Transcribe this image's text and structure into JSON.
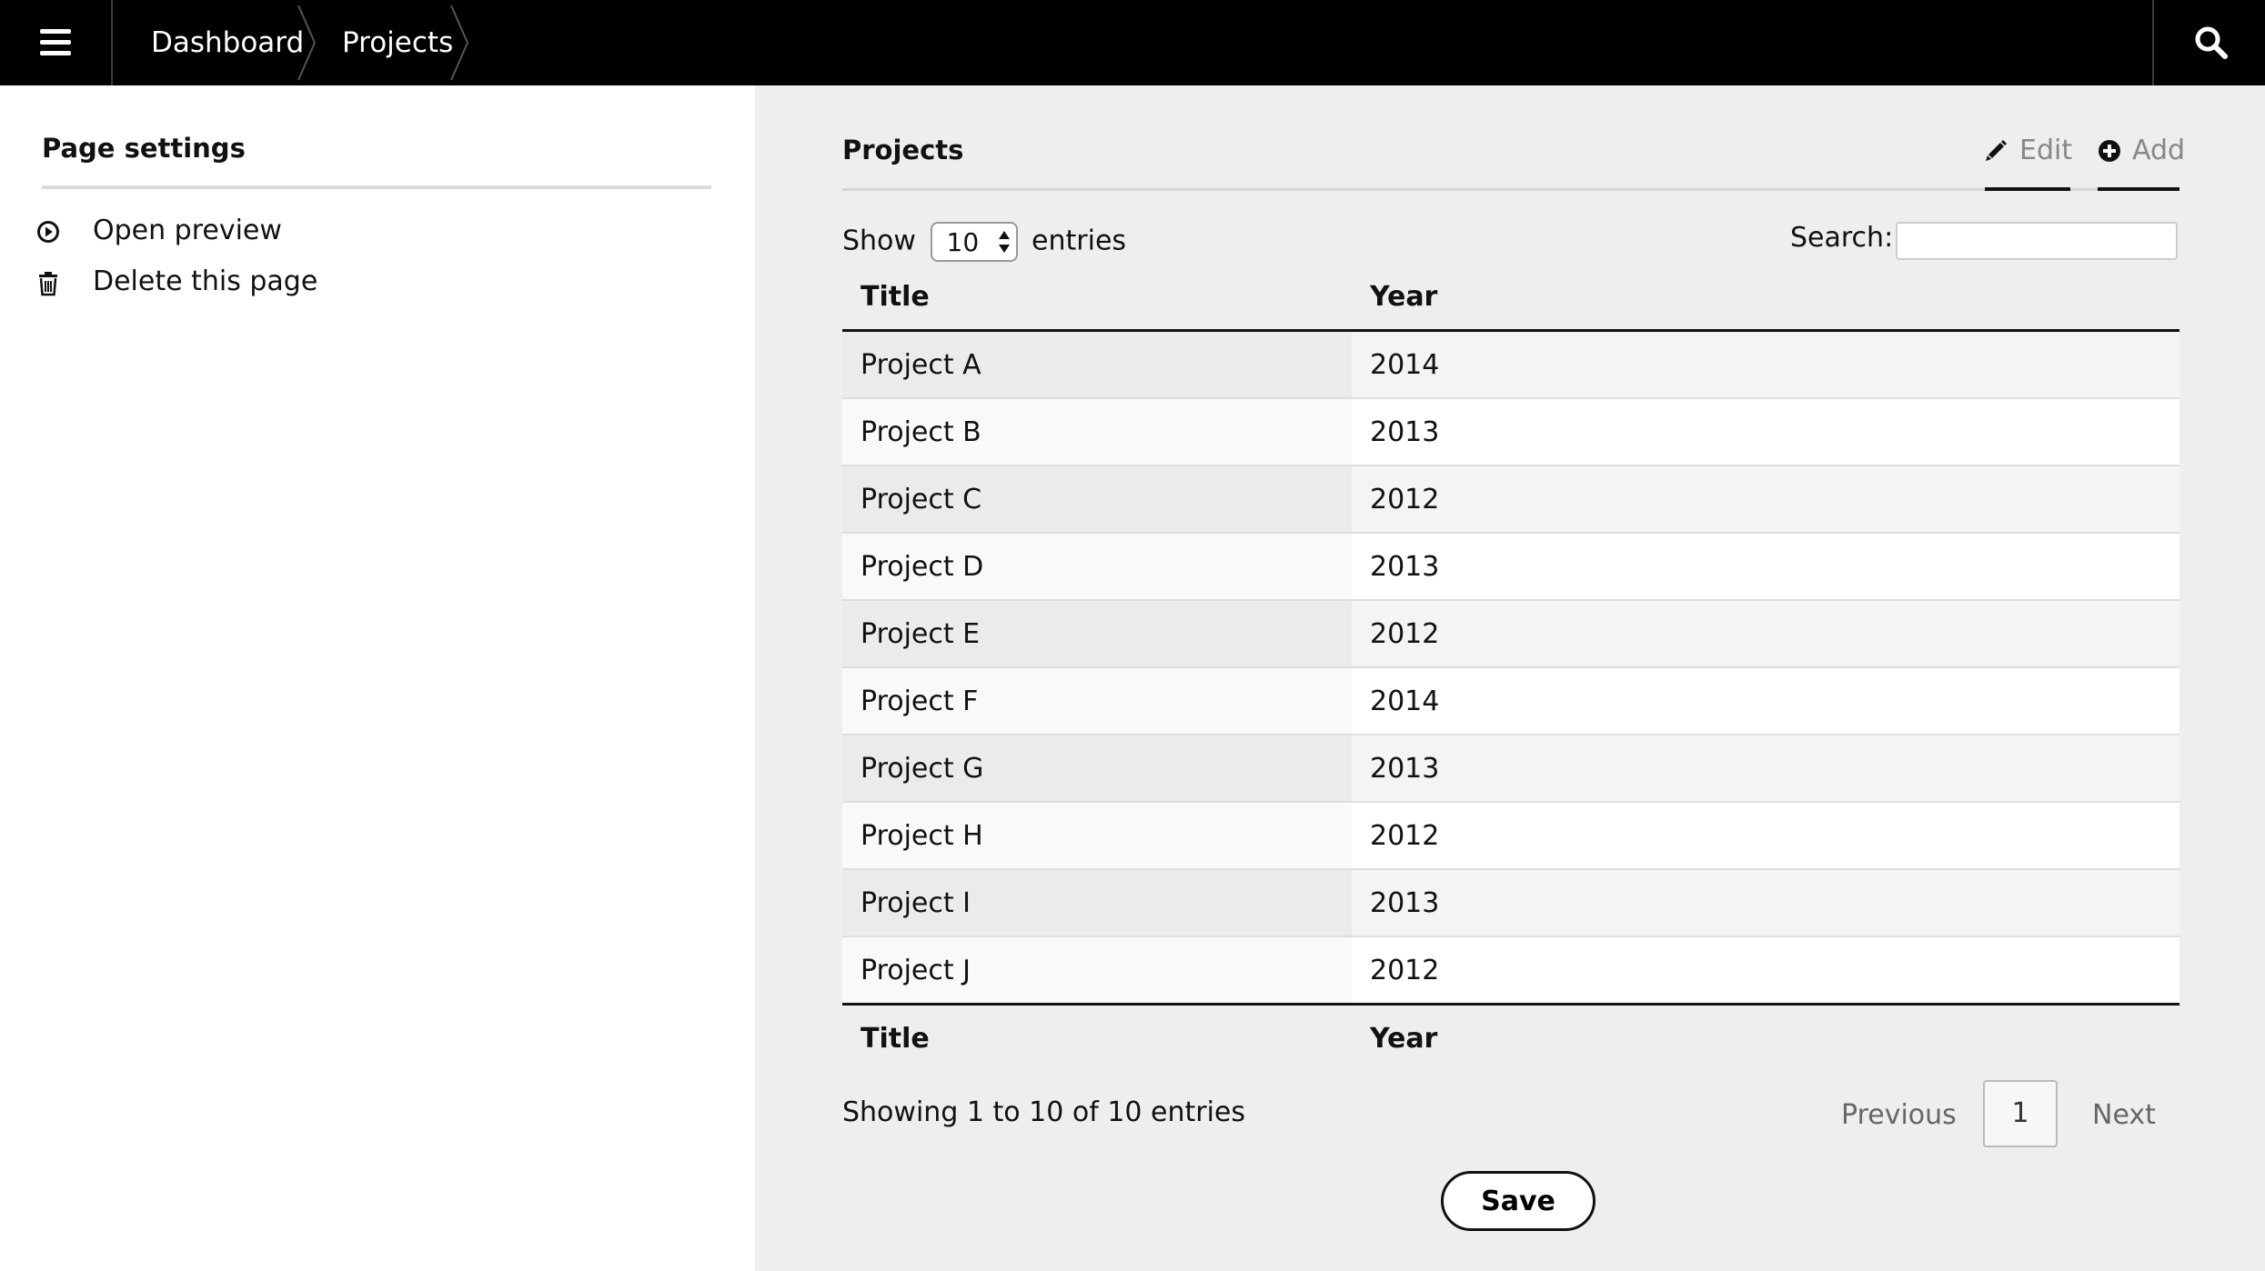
{
  "topbar": {
    "breadcrumbs": [
      "Dashboard",
      "Projects"
    ],
    "menu_icon": "hamburger-icon",
    "search_icon": "search-icon"
  },
  "sidebar": {
    "title": "Page settings",
    "items": [
      {
        "label": "Open preview",
        "icon": "play-circle-icon"
      },
      {
        "label": "Delete this page",
        "icon": "trash-icon"
      }
    ]
  },
  "main": {
    "title": "Projects",
    "actions": [
      {
        "label": "Edit",
        "icon": "pencil-icon"
      },
      {
        "label": "Add",
        "icon": "plus-circle-icon"
      }
    ],
    "length": {
      "show_label": "Show",
      "value": "10",
      "entries_label": "entries"
    },
    "search": {
      "label": "Search:",
      "value": ""
    },
    "table": {
      "columns": [
        "Title",
        "Year"
      ],
      "rows": [
        [
          "Project A",
          "2014"
        ],
        [
          "Project B",
          "2013"
        ],
        [
          "Project C",
          "2012"
        ],
        [
          "Project D",
          "2013"
        ],
        [
          "Project E",
          "2012"
        ],
        [
          "Project F",
          "2014"
        ],
        [
          "Project G",
          "2013"
        ],
        [
          "Project H",
          "2012"
        ],
        [
          "Project I",
          "2013"
        ],
        [
          "Project J",
          "2012"
        ]
      ]
    },
    "info": "Showing 1 to 10 of 10 entries",
    "pagination": {
      "previous": "Previous",
      "current": "1",
      "next": "Next"
    },
    "save_label": "Save"
  },
  "colors": {
    "topbar": "#000000",
    "main_bg": "#eeeeee",
    "text": "#111111",
    "muted": "#888888"
  }
}
